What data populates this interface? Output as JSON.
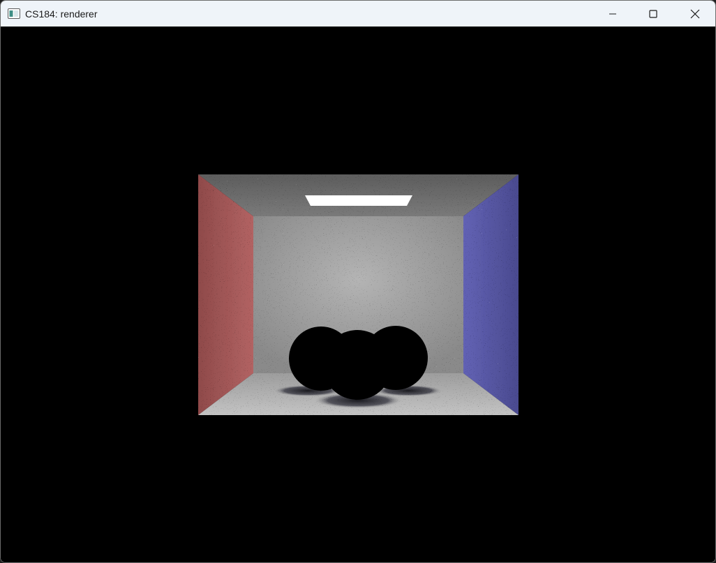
{
  "window": {
    "title": "CS184: renderer",
    "icon": "app-window-icon",
    "controls": {
      "minimize": "minimize-icon",
      "maximize": "maximize-icon",
      "close": "close-icon"
    }
  },
  "scene": {
    "description_icon": "cornell-box-render",
    "colors": {
      "background": "#000000",
      "left_wall": "#a85858",
      "right_wall": "#5a5aa8",
      "back_wall": "#a6a6a6",
      "floor": "#b8b8b8",
      "ceiling": "#6e6e6e",
      "light": "#ffffff",
      "spheres": "#000000"
    }
  }
}
